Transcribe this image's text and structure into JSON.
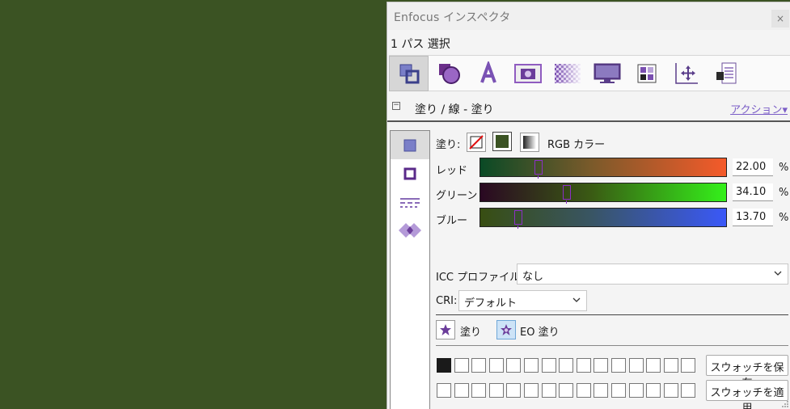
{
  "colors": {
    "canvas_bg": "#3b5323",
    "accent": "#7b5ec7",
    "thumb": "#8c2fc7"
  },
  "window": {
    "title": "Enfocus インスペクタ",
    "close_label": "×"
  },
  "selection_status": "1 パス 選択",
  "toolbar": {
    "icons": [
      "fill-stroke-icon",
      "shape-icon",
      "text-icon",
      "image-icon",
      "transparency-icon",
      "display-icon",
      "grid-icon",
      "position-icon",
      "document-icon"
    ],
    "active_index": 0
  },
  "section": {
    "collapse_symbol": "⊟",
    "title": "塗り / 線 - 塗り",
    "action_label": "アクション▾"
  },
  "sidebar": {
    "icons": [
      "fill-icon",
      "stroke-icon",
      "dashed-stroke-icon",
      "overprint-icon"
    ],
    "active_index": 0
  },
  "fill": {
    "label": "塗り:",
    "color_model": "RGB カラー"
  },
  "sliders": [
    {
      "label": "レッド",
      "value": "22.00",
      "fraction": 0.22,
      "unit": "%"
    },
    {
      "label": "グリーン",
      "value": "34.10",
      "fraction": 0.341,
      "unit": "%"
    },
    {
      "label": "ブルー",
      "value": "13.70",
      "fraction": 0.137,
      "unit": "%"
    }
  ],
  "icc": {
    "label": "ICC プロファイル:",
    "value": "なし"
  },
  "cri": {
    "label": "CRI:",
    "value": "デフォルト"
  },
  "fill_rule": {
    "nonzero_label": "塗り",
    "eo_label": "EO 塗り",
    "active": "eo"
  },
  "swatches": {
    "save_label": "スウォッチを保存",
    "apply_label": "スウォッチを適用",
    "row1_first": "#1a1a1a"
  }
}
